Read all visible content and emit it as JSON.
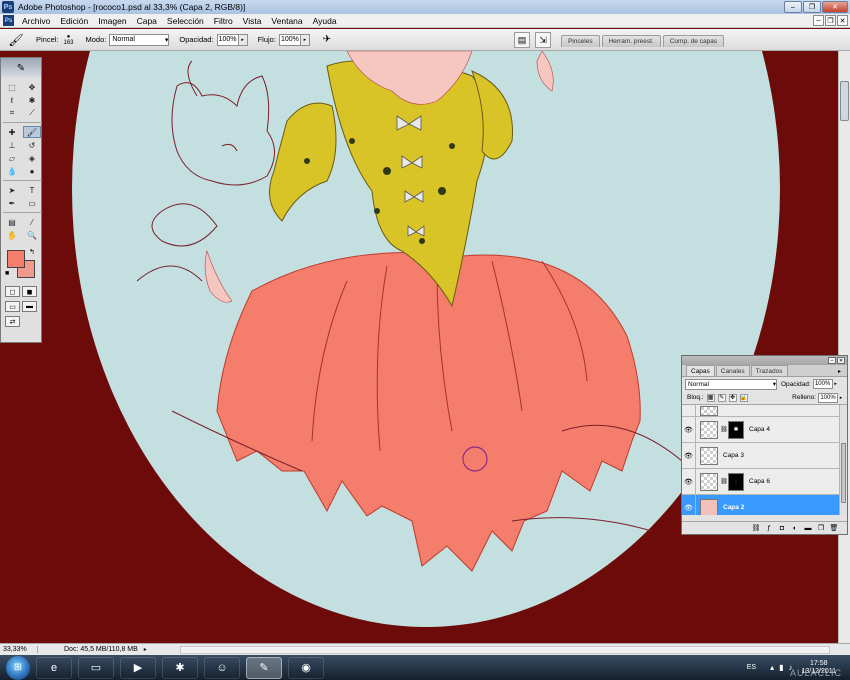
{
  "window": {
    "title": "Adobe Photoshop - [rococo1.psd al 33,3% (Capa 2, RGB/8)]",
    "buttons": [
      "–",
      "❐",
      "✕"
    ]
  },
  "menu": [
    "Archivo",
    "Edición",
    "Imagen",
    "Capa",
    "Selección",
    "Filtro",
    "Vista",
    "Ventana",
    "Ayuda"
  ],
  "options_bar": {
    "brush_label": "Pincel:",
    "brush_size": "163",
    "mode_label": "Modo:",
    "mode_value": "Normal",
    "opacity_label": "Opacidad:",
    "opacity_value": "100%",
    "flow_label": "Flujo:",
    "flow_value": "100%",
    "well_tabs": [
      "Pinceles",
      "Herram. preest.",
      "Comp. de capas"
    ]
  },
  "colors": {
    "foreground": "#f47d6c",
    "background": "#f09a8e",
    "canvas_bg": "#6d0a0a",
    "oval": "#c3dfe0",
    "dress": "#f47d6c",
    "bodice": "#d9c428",
    "selected_layer": "#3a9aff"
  },
  "layers_panel": {
    "tabs": [
      "Capas",
      "Canales",
      "Trazados"
    ],
    "blend_mode": "Normal",
    "opacity_label": "Opacidad:",
    "opacity_value": "100%",
    "lock_label": "Bloq.:",
    "fill_label": "Relleno:",
    "fill_value": "100%",
    "layers": [
      {
        "name": "Capa 4",
        "has_mask": true,
        "visible": true,
        "selected": false
      },
      {
        "name": "Capa 3",
        "has_mask": false,
        "visible": true,
        "selected": false
      },
      {
        "name": "Capa 6",
        "has_mask": true,
        "visible": true,
        "selected": false
      },
      {
        "name": "Capa 2",
        "has_mask": false,
        "visible": true,
        "selected": true
      }
    ]
  },
  "status_bar": {
    "zoom": "33,33%",
    "doc": "Doc: 45,5 MB/110,8 MB"
  },
  "taskbar": {
    "lang": "ES",
    "time": "17:58",
    "date": "13/12/2011",
    "watermark": "AULACLIC"
  }
}
